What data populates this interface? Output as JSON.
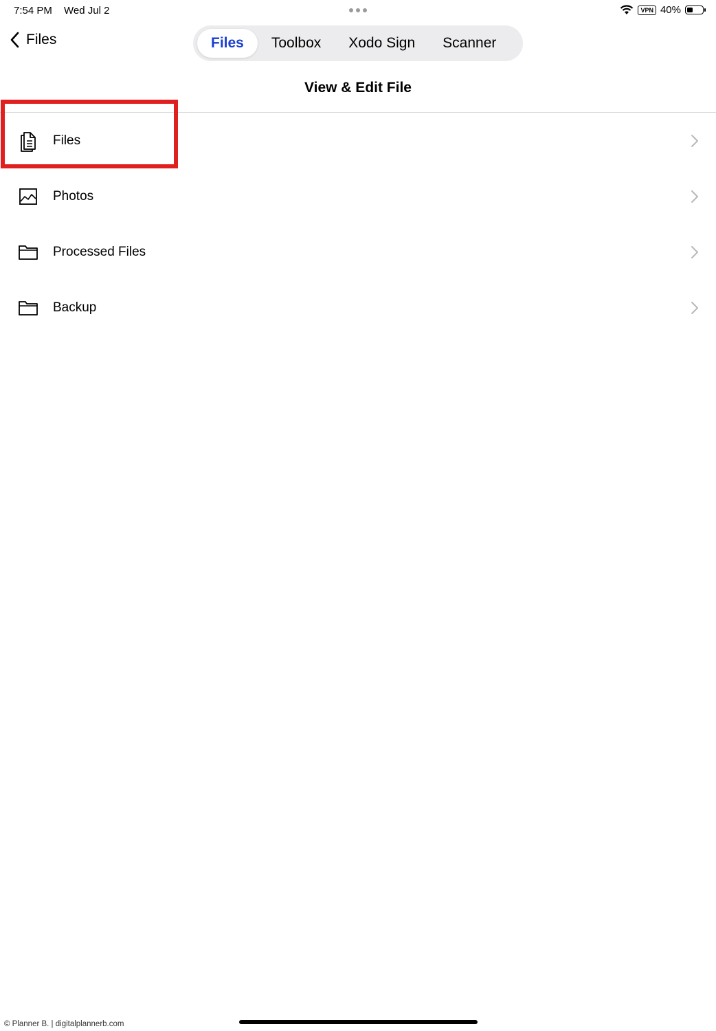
{
  "status_bar": {
    "time": "7:54 PM",
    "date": "Wed Jul 2",
    "vpn": "VPN",
    "battery_percent": "40%",
    "battery_level": 0.4
  },
  "nav": {
    "back_label": "Files",
    "tabs": [
      {
        "label": "Files",
        "active": true
      },
      {
        "label": "Toolbox",
        "active": false
      },
      {
        "label": "Xodo Sign",
        "active": false
      },
      {
        "label": "Scanner",
        "active": false
      }
    ]
  },
  "page_title": "View & Edit File",
  "items": [
    {
      "label": "Files",
      "icon": "document-icon"
    },
    {
      "label": "Photos",
      "icon": "photo-icon"
    },
    {
      "label": "Processed Files",
      "icon": "folder-icon"
    },
    {
      "label": "Backup",
      "icon": "folder-icon"
    }
  ],
  "footer": "© Planner B. | digitalplannerb.com",
  "colors": {
    "accent": "#1a3fd1",
    "highlight": "#e0201f"
  }
}
